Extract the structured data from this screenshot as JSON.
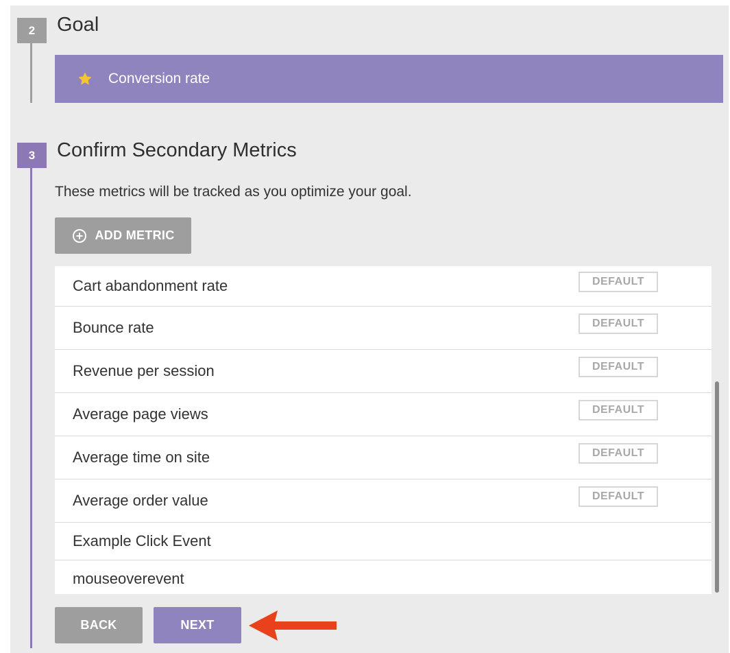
{
  "steps": {
    "goal": {
      "number": "2",
      "title": "Goal",
      "selected_goal": "Conversion rate"
    },
    "secondary": {
      "number": "3",
      "title": "Confirm Secondary Metrics",
      "description": "These metrics will be tracked as you optimize your goal.",
      "add_metric_label": "ADD METRIC"
    }
  },
  "metrics": [
    {
      "name": "Cart abandonment rate",
      "badge": "DEFAULT"
    },
    {
      "name": "Bounce rate",
      "badge": "DEFAULT"
    },
    {
      "name": "Revenue per session",
      "badge": "DEFAULT"
    },
    {
      "name": "Average page views",
      "badge": "DEFAULT"
    },
    {
      "name": "Average time on site",
      "badge": "DEFAULT"
    },
    {
      "name": "Average order value",
      "badge": "DEFAULT"
    },
    {
      "name": "Example Click Event",
      "badge": ""
    },
    {
      "name": "mouseoverevent",
      "badge": ""
    }
  ],
  "buttons": {
    "back": "BACK",
    "next": "NEXT"
  },
  "icons": {
    "goal": "star-icon",
    "add": "plus-circle-icon",
    "pointer": "arrow-left-icon"
  },
  "colors": {
    "purple": "#8f84bd",
    "grey": "#9e9e9e",
    "arrow": "#e8411c",
    "star": "#f7c531"
  }
}
